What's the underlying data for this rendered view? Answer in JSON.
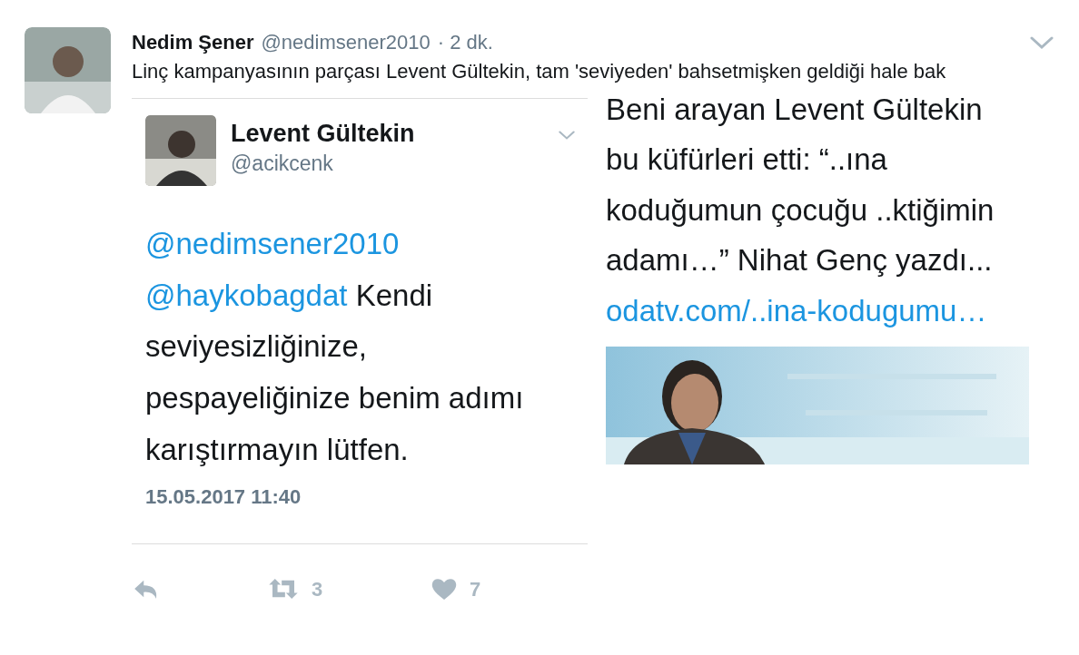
{
  "tweet": {
    "author": "Nedim Şener",
    "handle": "@nedimsener2010",
    "time": "· 2 dk.",
    "text": "Linç kampanyasının parçası Levent Gültekin, tam 'seviyeden' bahsetmişken geldiği hale bak",
    "media": [
      {
        "kind": "screenshot",
        "author": "Levent Gültekin",
        "handle": "@acikcenk",
        "body": [
          {
            "kind": "link",
            "text": "@nedimsener2010"
          },
          {
            "kind": "link",
            "text": "@haykobagdat"
          },
          {
            "kind": "text",
            "text": "Kendi seviyesizliğinize, pespayeliğinize benim adımı karıştırmayın lütfen."
          }
        ],
        "date": "15.05.2017 11:40"
      },
      {
        "kind": "article",
        "body": [
          {
            "kind": "text",
            "text": "Beni arayan Levent Gültekin bu küfürleri etti: “..ına koduğumun çocuğu ..ktiğimin adamı…” Nihat Genç yazdı..."
          },
          {
            "kind": "link",
            "text": "odatv.com/..ina-kodugumu…"
          }
        ],
        "image": {
          "kind": "picture"
        }
      }
    ],
    "actions": [
      {
        "kind": "reply"
      },
      {
        "kind": "retweet",
        "count": "3"
      },
      {
        "kind": "like",
        "count": "7"
      }
    ]
  }
}
